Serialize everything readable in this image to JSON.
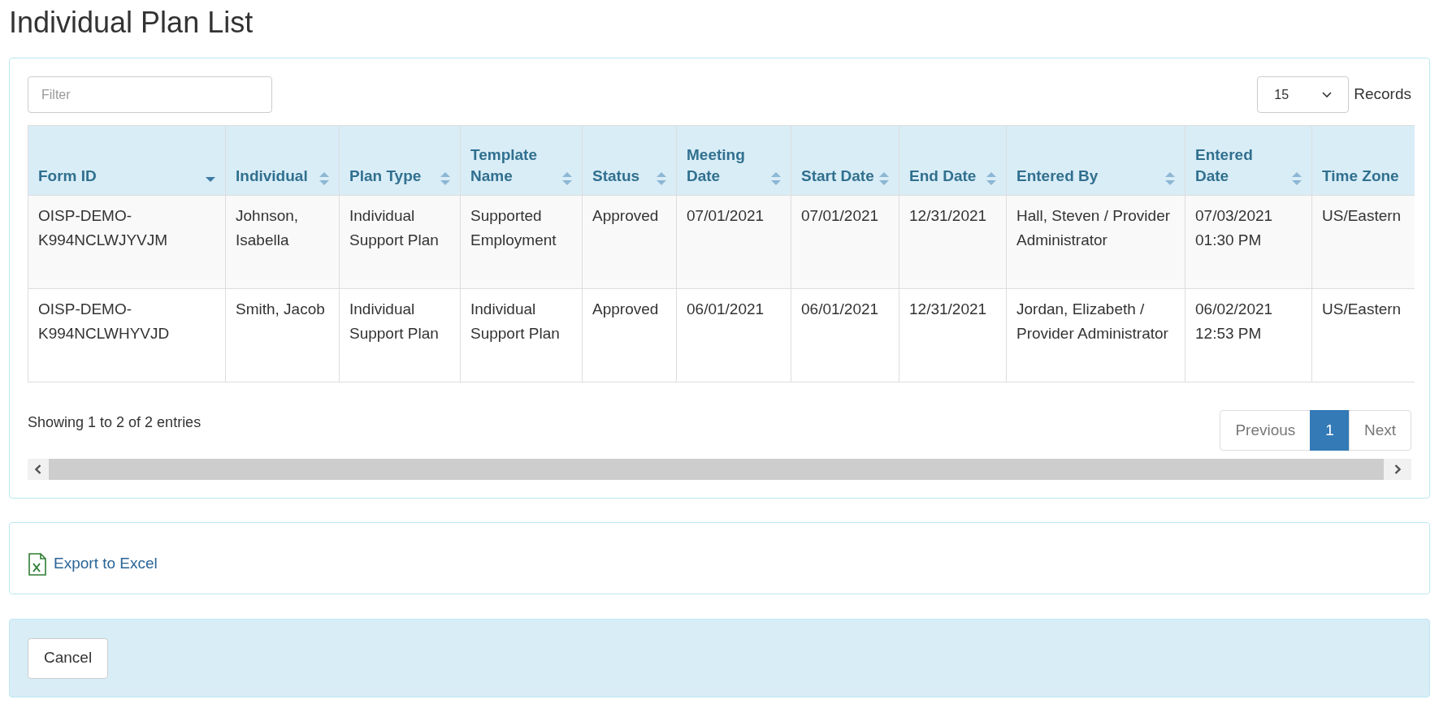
{
  "title": "Individual Plan List",
  "filter": {
    "placeholder": "Filter"
  },
  "page_size": {
    "value": "15",
    "label": "Records"
  },
  "table": {
    "columns": [
      {
        "label": "Form ID",
        "sorted": true
      },
      {
        "label": "Individual",
        "sorted": false
      },
      {
        "label": "Plan Type",
        "sorted": false
      },
      {
        "label": "Template Name",
        "sorted": false
      },
      {
        "label": "Status",
        "sorted": false
      },
      {
        "label": "Meeting Date",
        "sorted": false
      },
      {
        "label": "Start Date",
        "sorted": false
      },
      {
        "label": "End Date",
        "sorted": false
      },
      {
        "label": "Entered By",
        "sorted": false
      },
      {
        "label": "Entered Date",
        "sorted": false
      },
      {
        "label": "Time Zone"
      }
    ],
    "rows": [
      [
        "OISP-DEMO-K994NCLWJYVJM",
        "Johnson, Isabella",
        "Individual Support Plan",
        "Supported Employment",
        "Approved",
        "07/01/2021",
        "07/01/2021",
        "12/31/2021",
        "Hall, Steven / Provider Administrator",
        "07/03/2021 01:30 PM",
        "US/Eastern"
      ],
      [
        "OISP-DEMO-K994NCLWHYVJD",
        "Smith, Jacob",
        "Individual Support Plan",
        "Individual Support Plan",
        "Approved",
        "06/01/2021",
        "06/01/2021",
        "12/31/2021",
        "Jordan, Elizabeth / Provider Administrator",
        "06/02/2021 12:53 PM",
        "US/Eastern"
      ]
    ]
  },
  "info": "Showing 1 to 2 of 2 entries",
  "pagination": [
    {
      "label": "Previous",
      "selected": false
    },
    {
      "label": "1",
      "selected": true
    },
    {
      "label": "Next",
      "selected": false
    }
  ],
  "export_link": "Export to Excel",
  "cancel_button": "Cancel"
}
